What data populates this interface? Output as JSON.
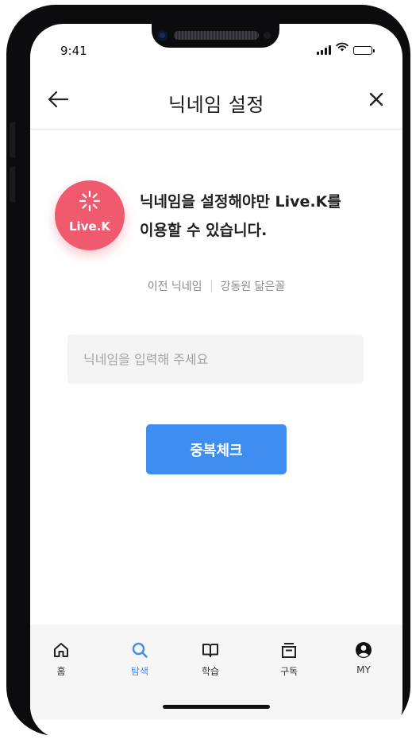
{
  "status_bar": {
    "time": "9:41",
    "icons": [
      "signal-icon",
      "wifi-icon",
      "battery-icon"
    ]
  },
  "header": {
    "title": "닉네임 설정",
    "back_icon": "arrow-left-icon",
    "close_icon": "close-icon"
  },
  "logo": {
    "text": "Live.K",
    "color": "#f05a6e"
  },
  "message": {
    "line1": "닉네임을 설정해야만 Live.K를",
    "line2": "이용할 수 있습니다."
  },
  "previous_nickname": {
    "label": "이전 닉네임",
    "value": "강동원 닮은꼴"
  },
  "nickname_input": {
    "placeholder": "닉네임을 입력해 주세요",
    "value": ""
  },
  "check_button": {
    "label": "중복체크",
    "color": "#3d8ef0"
  },
  "bottom_nav": {
    "active": "탐색",
    "items": [
      {
        "label": "홈",
        "icon": "home-icon"
      },
      {
        "label": "탐색",
        "icon": "search-icon"
      },
      {
        "label": "학습",
        "icon": "book-icon"
      },
      {
        "label": "구독",
        "icon": "subscription-icon"
      },
      {
        "label": "MY",
        "icon": "profile-icon"
      }
    ]
  }
}
